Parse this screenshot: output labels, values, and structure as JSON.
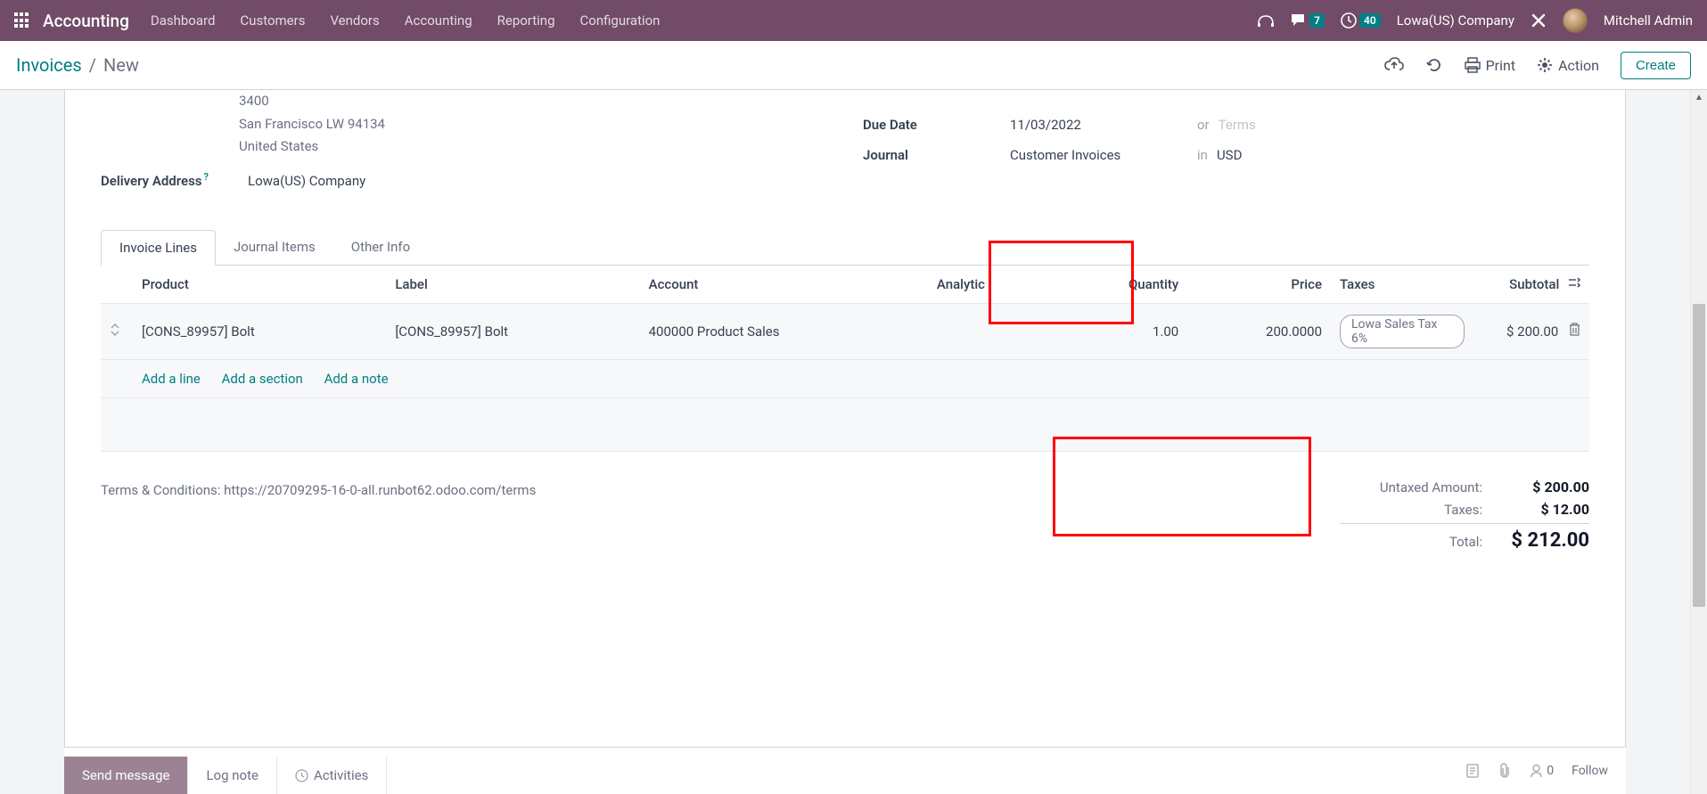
{
  "navbar": {
    "brand": "Accounting",
    "menu": [
      "Dashboard",
      "Customers",
      "Vendors",
      "Accounting",
      "Reporting",
      "Configuration"
    ],
    "messages_badge": "7",
    "activities_badge": "40",
    "company": "Lowa(US) Company",
    "user": "Mitchell Admin"
  },
  "control_panel": {
    "breadcrumb_root": "Invoices",
    "breadcrumb_current": "New",
    "print": "Print",
    "action": "Action",
    "create": "Create"
  },
  "form": {
    "address_line1": "3400",
    "address_line2": "San Francisco LW 94134",
    "address_line3": "United States",
    "delivery_label": "Delivery Address",
    "delivery_value": "Lowa(US) Company",
    "due_date_label": "Due Date",
    "due_date_value": "11/03/2022",
    "due_date_or": "or",
    "due_date_terms": "Terms",
    "journal_label": "Journal",
    "journal_value": "Customer Invoices",
    "journal_in": "in",
    "journal_currency": "USD"
  },
  "tabs": [
    "Invoice Lines",
    "Journal Items",
    "Other Info"
  ],
  "table": {
    "headers": {
      "product": "Product",
      "label": "Label",
      "account": "Account",
      "analytic": "Analytic",
      "quantity": "Quantity",
      "price": "Price",
      "taxes": "Taxes",
      "subtotal": "Subtotal"
    },
    "row": {
      "product": "[CONS_89957] Bolt",
      "label": "[CONS_89957] Bolt",
      "account": "400000 Product Sales",
      "analytic": "",
      "quantity": "1.00",
      "price": "200.0000",
      "tax": "Lowa Sales Tax 6%",
      "subtotal": "$ 200.00"
    },
    "add_line": "Add a line",
    "add_section": "Add a section",
    "add_note": "Add a note"
  },
  "footer": {
    "terms": "Terms & Conditions: https://20709295-16-0-all.runbot62.odoo.com/terms",
    "untaxed_label": "Untaxed Amount:",
    "untaxed_val": "$ 200.00",
    "taxes_label": "Taxes:",
    "taxes_val": "$ 12.00",
    "total_label": "Total:",
    "total_val": "$ 212.00"
  },
  "chatter": {
    "send": "Send message",
    "log": "Log note",
    "activities": "Activities",
    "followers": "0",
    "follow": "Follow"
  }
}
